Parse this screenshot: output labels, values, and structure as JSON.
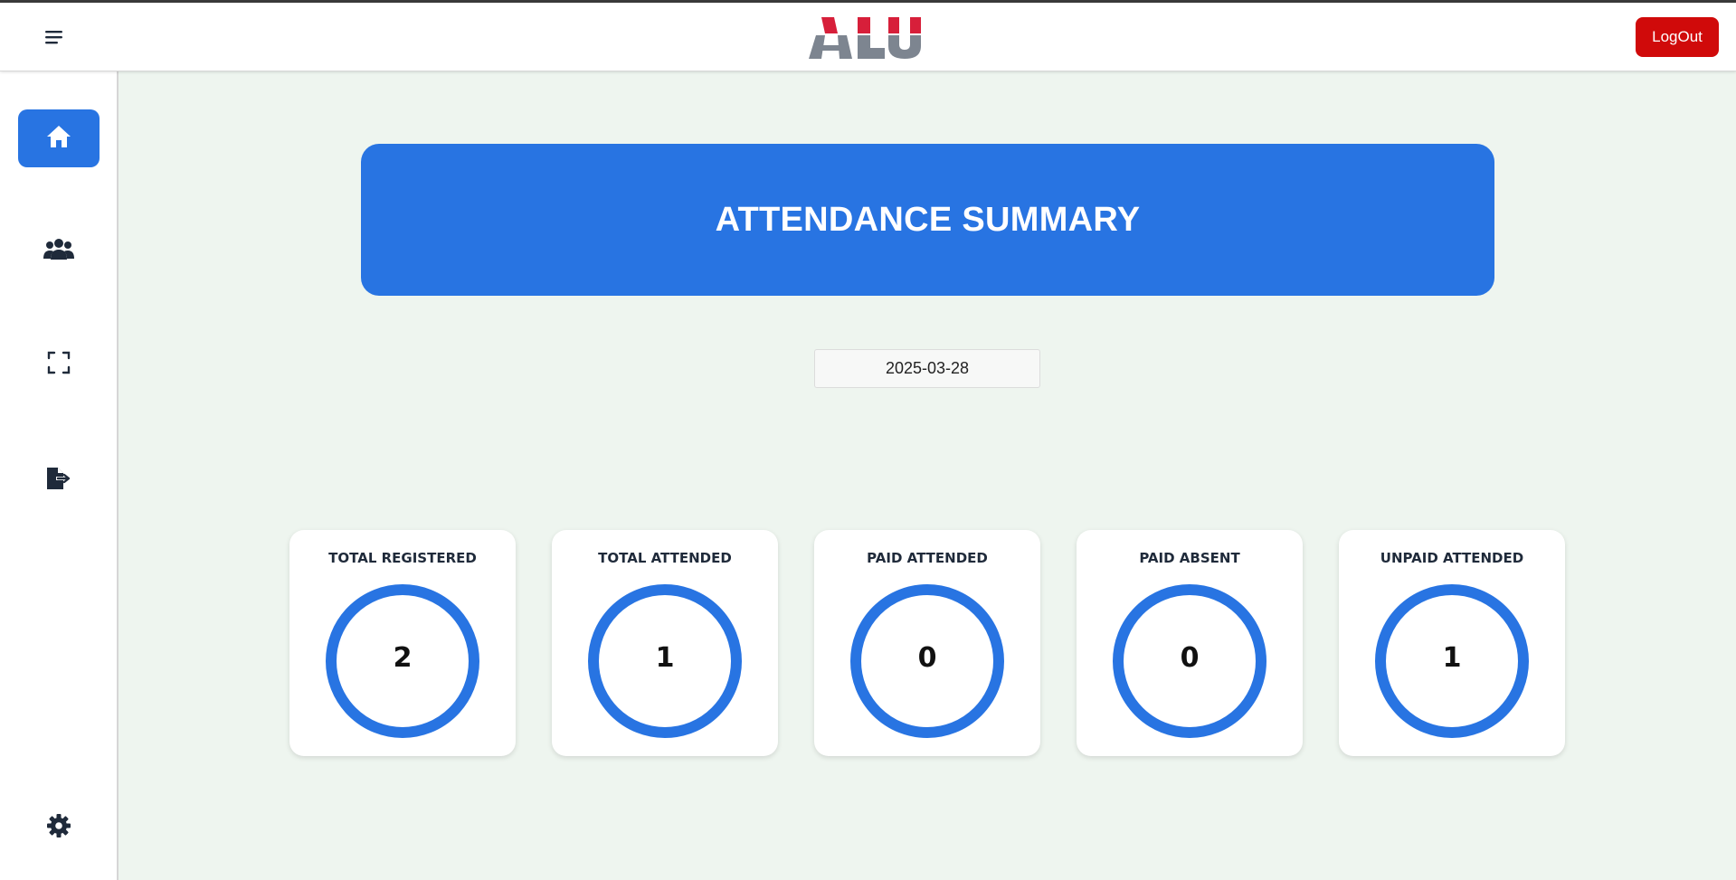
{
  "header": {
    "logo_text": "ALU",
    "logout_label": "LogOut"
  },
  "sidebar": {
    "items": [
      {
        "name": "home",
        "icon": "home-icon",
        "active": true
      },
      {
        "name": "users",
        "icon": "users-icon",
        "active": false
      },
      {
        "name": "scan",
        "icon": "scan-icon",
        "active": false
      },
      {
        "name": "export",
        "icon": "file-export-icon",
        "active": false
      },
      {
        "name": "settings",
        "icon": "gear-icon",
        "active": false
      }
    ]
  },
  "main": {
    "title": "ATTENDANCE SUMMARY",
    "date_value": "2025-03-28",
    "cards": [
      {
        "label": "TOTAL REGISTERED",
        "value": "2"
      },
      {
        "label": "TOTAL ATTENDED",
        "value": "1"
      },
      {
        "label": "PAID ATTENDED",
        "value": "0"
      },
      {
        "label": "PAID ABSENT",
        "value": "0"
      },
      {
        "label": "UNPAID ATTENDED",
        "value": "1"
      }
    ]
  },
  "colors": {
    "accent": "#2874e2",
    "logout": "#d00a0a",
    "background": "#eef5ef",
    "icon": "#1f2a3a",
    "logo_red": "#d71f3a",
    "logo_gray": "#7d8590"
  }
}
